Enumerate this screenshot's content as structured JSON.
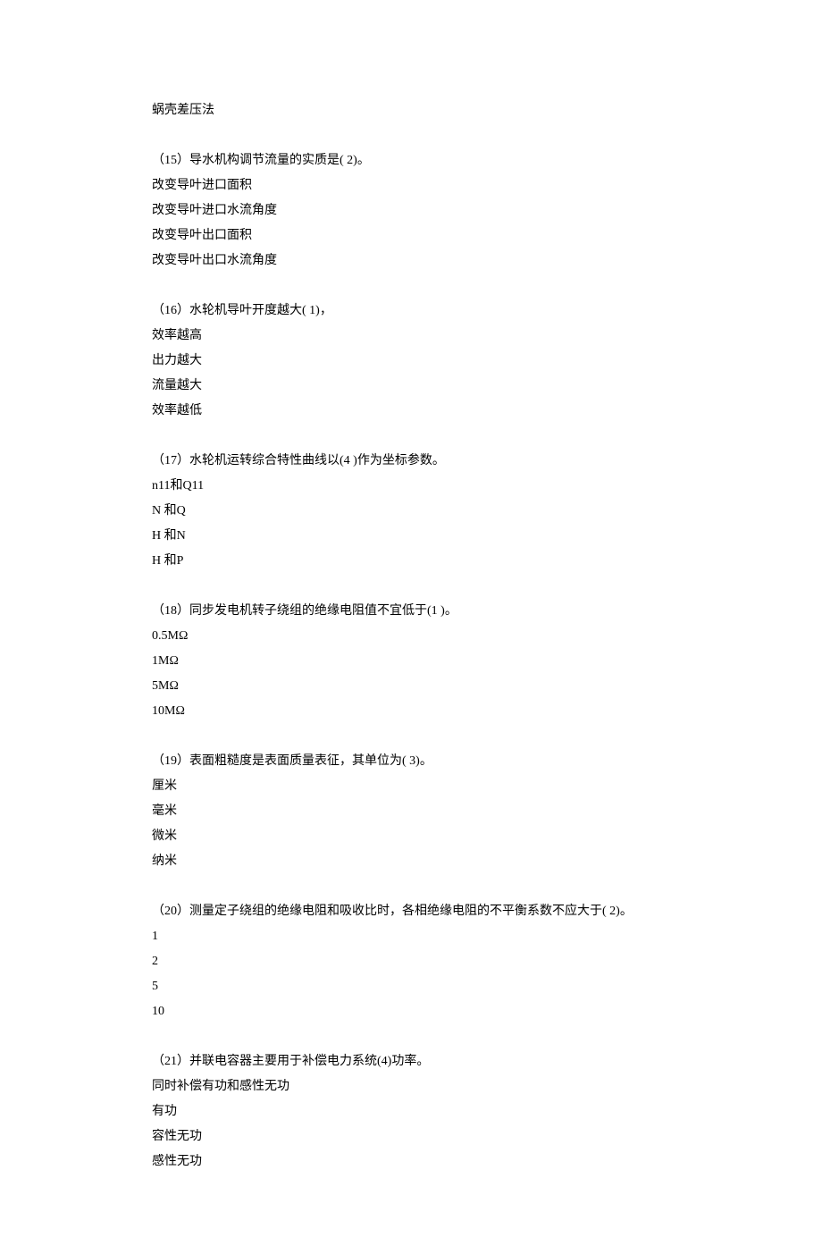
{
  "preLine": "蜗壳差压法",
  "questions": [
    {
      "stem": "（15）导水机构调节流量的实质是( 2)。",
      "opts": [
        "改变导叶进口面积",
        "改变导叶进口水流角度",
        "改变导叶出口面积",
        "改变导叶出口水流角度"
      ]
    },
    {
      "stem": "（16）水轮机导叶开度越大( 1)，",
      "opts": [
        "效率越高",
        "出力越大",
        "流量越大",
        "效率越低"
      ]
    },
    {
      "stem": "（17）水轮机运转综合特性曲线以(4 )作为坐标参数。",
      "opts": [
        "n11和Q11",
        "N 和Q",
        "H 和N",
        "H 和P"
      ]
    },
    {
      "stem": "（18）同步发电机转子绕组的绝缘电阻值不宜低于(1 )。",
      "opts": [
        "0.5MΩ",
        "1MΩ",
        "5MΩ",
        "10MΩ"
      ]
    },
    {
      "stem": "（19）表面粗糙度是表面质量表征，其单位为( 3)。",
      "opts": [
        "厘米",
        "毫米",
        "微米",
        "纳米"
      ]
    },
    {
      "stem": "（20）测量定子绕组的绝缘电阻和吸收比时，各相绝缘电阻的不平衡系数不应大于( 2)。",
      "opts": [
        "1",
        "2",
        "5",
        "10"
      ]
    },
    {
      "stem": "（21）并联电容器主要用于补偿电力系统(4)功率。",
      "opts": [
        "同时补偿有功和感性无功",
        "有功",
        "容性无功",
        "感性无功"
      ]
    }
  ]
}
